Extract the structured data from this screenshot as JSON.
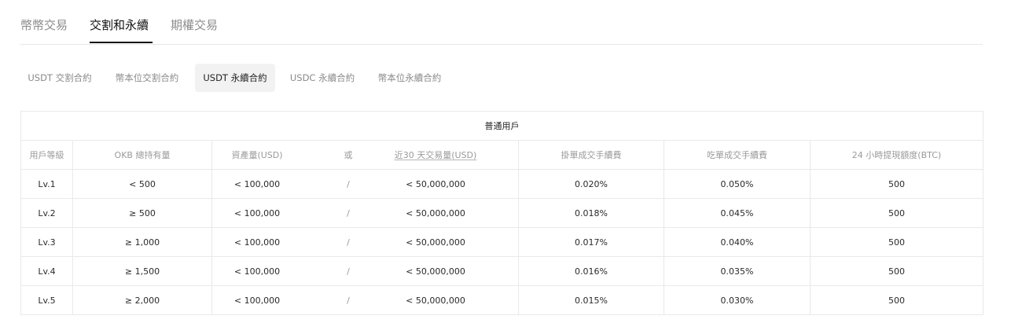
{
  "top_tabs": [
    {
      "label": "幣幣交易",
      "active": false
    },
    {
      "label": "交割和永續",
      "active": true
    },
    {
      "label": "期權交易",
      "active": false
    }
  ],
  "sub_tabs": [
    {
      "label": "USDT 交割合約",
      "active": false
    },
    {
      "label": "幣本位交割合約",
      "active": false
    },
    {
      "label": "USDT 永續合約",
      "active": true
    },
    {
      "label": "USDC 永續合約",
      "active": false
    },
    {
      "label": "幣本位永續合約",
      "active": false
    }
  ],
  "table": {
    "group_title": "普通用戶",
    "headers": {
      "level": "用戶等級",
      "okb": "OKB 總持有量",
      "assets": "資產量(USD)",
      "or": "或",
      "volume": "近30 天交易量(USD)",
      "maker": "掛單成交手續費",
      "taker": "吃單成交手續費",
      "withdraw": "24 小時提現額度(BTC)"
    },
    "rows": [
      {
        "level": "Lv.1",
        "okb": "< 500",
        "assets": "< 100,000",
        "sep": "/",
        "volume": "< 50,000,000",
        "maker": "0.020%",
        "taker": "0.050%",
        "withdraw": "500"
      },
      {
        "level": "Lv.2",
        "okb": "≥ 500",
        "assets": "< 100,000",
        "sep": "/",
        "volume": "< 50,000,000",
        "maker": "0.018%",
        "taker": "0.045%",
        "withdraw": "500"
      },
      {
        "level": "Lv.3",
        "okb": "≥ 1,000",
        "assets": "< 100,000",
        "sep": "/",
        "volume": "< 50,000,000",
        "maker": "0.017%",
        "taker": "0.040%",
        "withdraw": "500"
      },
      {
        "level": "Lv.4",
        "okb": "≥ 1,500",
        "assets": "< 100,000",
        "sep": "/",
        "volume": "< 50,000,000",
        "maker": "0.016%",
        "taker": "0.035%",
        "withdraw": "500"
      },
      {
        "level": "Lv.5",
        "okb": "≥ 2,000",
        "assets": "< 100,000",
        "sep": "/",
        "volume": "< 50,000,000",
        "maker": "0.015%",
        "taker": "0.030%",
        "withdraw": "500"
      }
    ]
  }
}
